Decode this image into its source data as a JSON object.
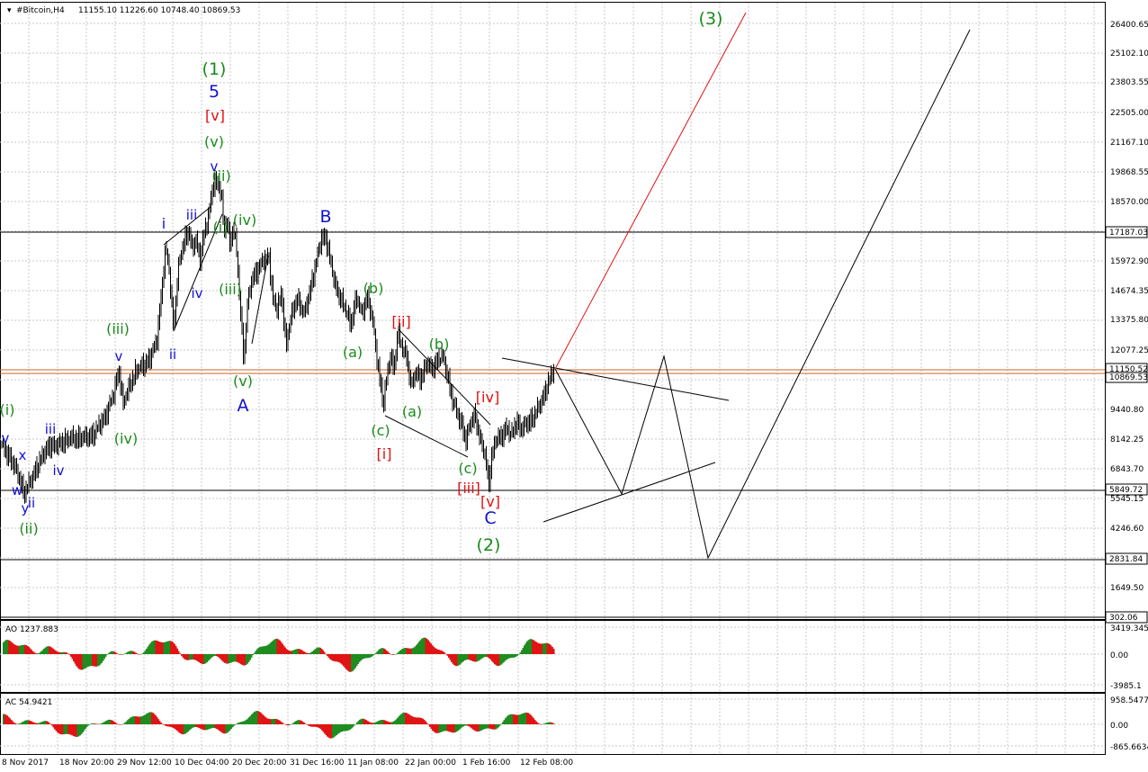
{
  "header": {
    "symbol": "#Bitcoin,H4",
    "ohlc": "11155.10 11226.60 10748.40 10869.53"
  },
  "ao": {
    "label": "AO 1237.883",
    "ticks": [
      "3419.345",
      "0.00",
      "-3985.1"
    ]
  },
  "ac": {
    "label": "AC 54.9421",
    "ticks": [
      "958.5477",
      "0.00",
      "-865.6634"
    ]
  },
  "price_axis": {
    "ticks": [
      "26400.65",
      "25102.10",
      "23803.55",
      "22505.00",
      "21167.10",
      "19868.55",
      "18570.00",
      "15972.90",
      "14674.35",
      "13375.80",
      "12077.25",
      "9440.80",
      "8142.25",
      "6843.70",
      "5545.15",
      "4246.60",
      "1649.50"
    ],
    "boxed": [
      "17187.03",
      "11150.52",
      "10869.53",
      "5849.72",
      "2831.84",
      "302.06"
    ]
  },
  "time_axis": [
    "8 Nov 2017",
    "18 Nov 20:00",
    "29 Nov 12:00",
    "10 Dec 04:00",
    "20 Dec 20:00",
    "31 Dec 16:00",
    "11 Jan 08:00",
    "22 Jan 00:00",
    "1 Feb 16:00",
    "12 Feb 08:00"
  ],
  "wave_labels": [
    {
      "text": "(3)",
      "color": "green"
    },
    {
      "text": "(1)",
      "color": "green"
    },
    {
      "text": "5",
      "color": "blue"
    },
    {
      "text": "[v]",
      "color": "red"
    },
    {
      "text": "(v)",
      "color": "green"
    },
    {
      "text": "v",
      "color": "blue"
    },
    {
      "text": "(ii)",
      "color": "green"
    },
    {
      "text": "(iv)",
      "color": "green"
    },
    {
      "text": "i",
      "color": "blue"
    },
    {
      "text": "iii",
      "color": "blue"
    },
    {
      "text": "(i)",
      "color": "green"
    },
    {
      "text": "iv",
      "color": "blue"
    },
    {
      "text": "(iii)",
      "color": "green"
    },
    {
      "text": "B",
      "color": "blue"
    },
    {
      "text": "(b)",
      "color": "green"
    },
    {
      "text": "[ii]",
      "color": "red"
    },
    {
      "text": "(iii)",
      "color": "green"
    },
    {
      "text": "(a)",
      "color": "green"
    },
    {
      "text": "(b)",
      "color": "green"
    },
    {
      "text": "v",
      "color": "blue"
    },
    {
      "text": "ii",
      "color": "blue"
    },
    {
      "text": "(v)",
      "color": "green"
    },
    {
      "text": "A",
      "color": "blue"
    },
    {
      "text": "[iv]",
      "color": "red"
    },
    {
      "text": "(i)",
      "color": "green"
    },
    {
      "text": "iii",
      "color": "blue"
    },
    {
      "text": "(a)",
      "color": "green"
    },
    {
      "text": "(iv)",
      "color": "green"
    },
    {
      "text": "(c)",
      "color": "green"
    },
    {
      "text": "v",
      "color": "blue"
    },
    {
      "text": "[i]",
      "color": "red"
    },
    {
      "text": "x",
      "color": "blue"
    },
    {
      "text": "iv",
      "color": "blue"
    },
    {
      "text": "(c)",
      "color": "green"
    },
    {
      "text": "w",
      "color": "blue"
    },
    {
      "text": "[iii]",
      "color": "red"
    },
    {
      "text": "[v]",
      "color": "red"
    },
    {
      "text": "ii",
      "color": "blue"
    },
    {
      "text": "y",
      "color": "blue"
    },
    {
      "text": "C",
      "color": "blue"
    },
    {
      "text": "(ii)",
      "color": "green"
    },
    {
      "text": "(2)",
      "color": "green"
    }
  ],
  "colors": {
    "green": "#1b8a1b",
    "blue": "#1010d0",
    "red": "#e01010",
    "bull": "#1e8c1e",
    "bear": "#e01414",
    "grid": "#c8c8c8",
    "projection_red": "#e01010"
  }
}
